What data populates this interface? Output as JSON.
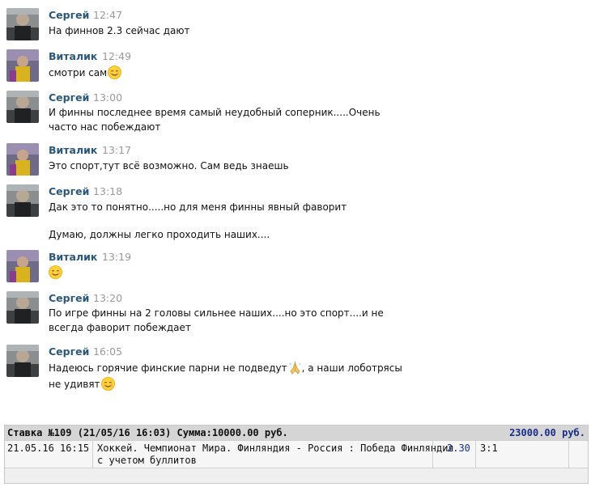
{
  "messages": [
    {
      "author": "Сергей",
      "time": "12:47",
      "avatar": "sergey",
      "lines": [
        "На финнов 2.3 сейчас дают"
      ]
    },
    {
      "author": "Виталик",
      "time": "12:49",
      "avatar": "vitalik",
      "lines": [
        "смотри сам"
      ],
      "emoji_after": "smiling-face-icon"
    },
    {
      "author": "Сергей",
      "time": "13:00",
      "avatar": "sergey",
      "lines": [
        "И финны последнее время самый неудобный соперник.....Очень",
        "часто нас побеждают"
      ]
    },
    {
      "author": "Виталик",
      "time": "13:17",
      "avatar": "vitalik",
      "lines": [
        "Это спорт,тут всё возможно. Сам ведь знаешь"
      ]
    },
    {
      "author": "Сергей",
      "time": "13:18",
      "avatar": "sergey",
      "lines": [
        "Дак это то понятно.....но для меня финны явный фаворит",
        "Думаю, должны легко проходить наших...."
      ]
    },
    {
      "author": "Виталик",
      "time": "13:19",
      "avatar": "vitalik",
      "lines": [
        ""
      ],
      "emoji_only": "smiling-face-icon"
    },
    {
      "author": "Сергей",
      "time": "13:20",
      "avatar": "sergey",
      "lines": [
        "По игре финны на 2 головы сильнее наших....но это спорт....и не",
        "всегда фаворит побеждает"
      ]
    },
    {
      "author": "Сергей",
      "time": "16:05",
      "avatar": "sergey",
      "lines": [
        "Надеюсь горячие финские парни не подведут",
        ", а наши лоботрясы",
        "не удивят"
      ]
    }
  ],
  "bet": {
    "header": "Ставка №109  (21/05/16 16:03) Сумма:10000.00 руб.",
    "total": "23000.00 руб.",
    "datetime": "21.05.16 16:15",
    "event_line1": "Хоккей. Чемпионат Мира. Финляндия - Россия : Победа Финляндия",
    "event_line2": "с учетом буллитов",
    "odds": "2.30",
    "score": "3:1"
  },
  "colors": {
    "author": "#2b587a",
    "time": "#999999",
    "total": "#1a2e8a",
    "header_bg": "#d5d5d5"
  }
}
